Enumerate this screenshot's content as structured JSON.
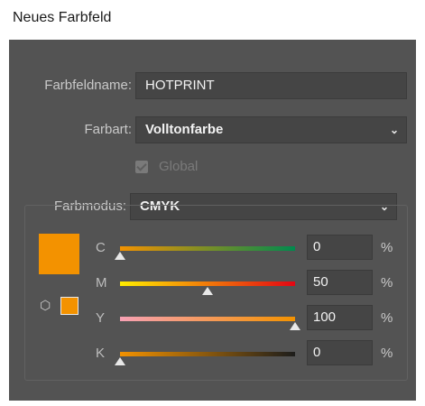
{
  "window": {
    "title": "Neues Farbfeld"
  },
  "swatch_name": {
    "label": "Farbfeldname:",
    "value": "HOTPRINT"
  },
  "color_type": {
    "label": "Farbart:",
    "value": "Volltonfarbe"
  },
  "global": {
    "label": "Global",
    "checked": true,
    "disabled": true
  },
  "color_mode": {
    "label": "Farbmodus:",
    "value": "CMYK"
  },
  "preview": {
    "color": "#f39200"
  },
  "channels": [
    {
      "label": "C",
      "value": "0",
      "unit": "%",
      "fraction": 0.0
    },
    {
      "label": "M",
      "value": "50",
      "unit": "%",
      "fraction": 0.5
    },
    {
      "label": "Y",
      "value": "100",
      "unit": "%",
      "fraction": 1.0
    },
    {
      "label": "K",
      "value": "0",
      "unit": "%",
      "fraction": 0.0
    }
  ],
  "colors": {
    "dialog_bg": "#535353",
    "field_bg": "#454545",
    "accent_orange": "#f39200"
  },
  "icons": {
    "dropdown": "chevron-down-icon",
    "gamut": "cube-icon",
    "check": "checkmark-icon"
  }
}
